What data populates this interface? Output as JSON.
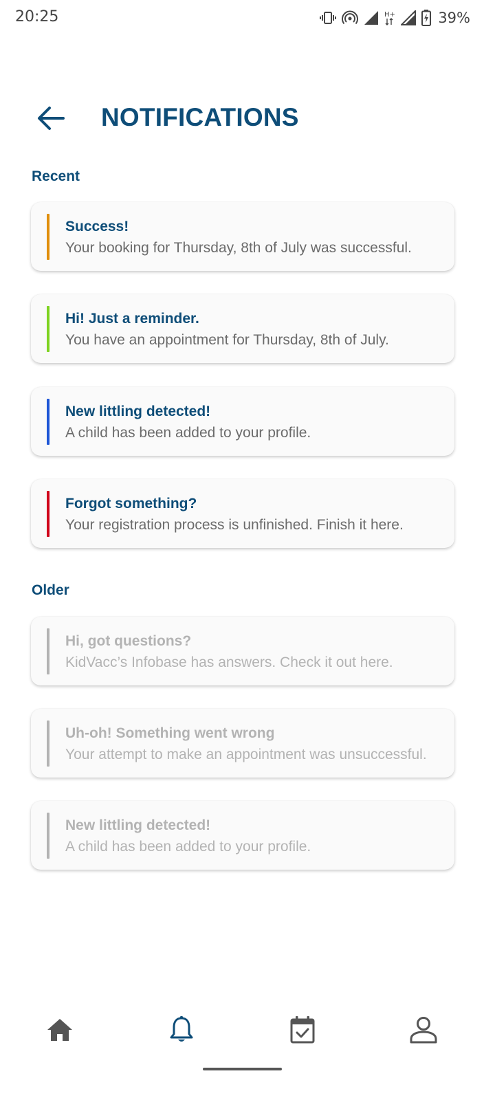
{
  "status_bar": {
    "time": "20:25",
    "battery": "39%",
    "icons": [
      "vibrate-icon",
      "hotspot-icon",
      "signal-icon",
      "h-plus-icon",
      "signal-icon",
      "battery-charging-icon"
    ]
  },
  "header": {
    "title": "NOTIFICATIONS",
    "back_icon": "arrow-left-icon"
  },
  "sections": {
    "recent": {
      "heading": "Recent",
      "items": [
        {
          "title": "Success!",
          "body": "Your booking for Thursday, 8th of July was successful.",
          "accent": "#e08e0b"
        },
        {
          "title": "Hi! Just a reminder.",
          "body": "You have an appointment for Thursday, 8th of July.",
          "accent": "#7ed321"
        },
        {
          "title": "New littling detected!",
          "body": "A child has been added to your profile.",
          "accent": "#1e56d6"
        },
        {
          "title": "Forgot something?",
          "body": "Your registration process is unfinished. Finish it here.",
          "accent": "#d0021b"
        }
      ]
    },
    "older": {
      "heading": "Older",
      "items": [
        {
          "title": "Hi, got questions?",
          "body": "KidVacc’s Infobase has answers. Check it out here.",
          "accent": "#b3b3b3"
        },
        {
          "title": "Uh-oh! Something went wrong",
          "body": "Your attempt to make an appointment was unsuccessful.",
          "accent": "#b3b3b3"
        },
        {
          "title": "New littling detected!",
          "body": "A child has been added to your profile.",
          "accent": "#b3b3b3"
        }
      ]
    }
  },
  "bottom_nav": {
    "items": [
      {
        "icon": "home-icon",
        "active": false
      },
      {
        "icon": "bell-icon",
        "active": true
      },
      {
        "icon": "calendar-check-icon",
        "active": false
      },
      {
        "icon": "profile-icon",
        "active": false
      }
    ]
  },
  "colors": {
    "primary": "#0e4d78",
    "inactive_icon": "#555555",
    "muted_text": "#b3b3b3"
  }
}
